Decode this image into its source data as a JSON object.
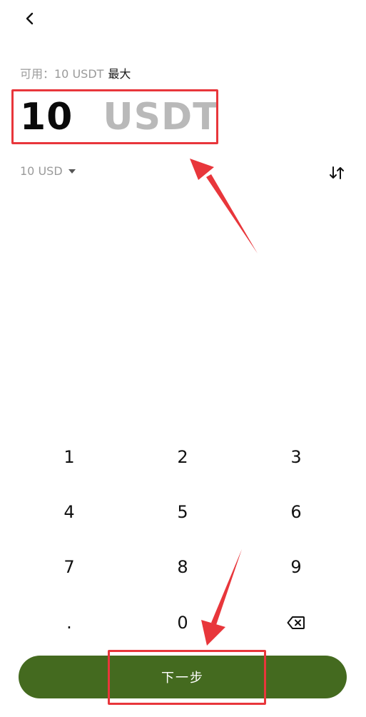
{
  "header": {
    "back_icon": "chevron-left-icon"
  },
  "available": {
    "label": "可用：10 USDT",
    "max_label": "最大"
  },
  "amount": {
    "value": "10",
    "unit": "USDT"
  },
  "fiat": {
    "label": "10 USD"
  },
  "swap": {
    "icon": "swap-vertical-icon"
  },
  "keypad": {
    "keys": [
      "1",
      "2",
      "3",
      "4",
      "5",
      "6",
      "7",
      "8",
      "9",
      ".",
      "0"
    ],
    "backspace_icon": "backspace-icon"
  },
  "footer": {
    "next_label": "下一步"
  },
  "colors": {
    "accent_green": "#446a1f",
    "annotation_red": "#e8363b",
    "muted_text": "#9a9a9a"
  }
}
